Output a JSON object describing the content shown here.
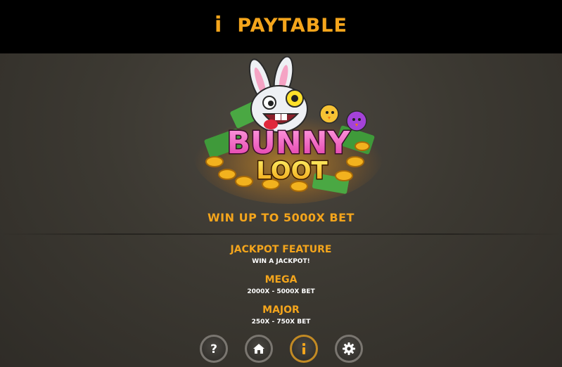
{
  "header": {
    "title": "PAYTABLE",
    "icon": "info-icon",
    "accent": "#f4a51c"
  },
  "logo": {
    "line1": "BUNNY",
    "line2": "LOOT"
  },
  "main": {
    "win_text": "WIN UP TO 5000X BET",
    "sections": [
      {
        "heading": "JACKPOT FEATURE",
        "text": "WIN A JACKPOT!"
      },
      {
        "heading": "MEGA",
        "text": "2000X - 5000X BET"
      },
      {
        "heading": "MAJOR",
        "text": "250X - 750X BET"
      }
    ]
  },
  "toolbar": {
    "buttons": [
      {
        "icon": "help-icon",
        "active": false
      },
      {
        "icon": "home-icon",
        "active": false
      },
      {
        "icon": "info-icon",
        "active": true
      },
      {
        "icon": "settings-icon",
        "active": false
      }
    ]
  }
}
